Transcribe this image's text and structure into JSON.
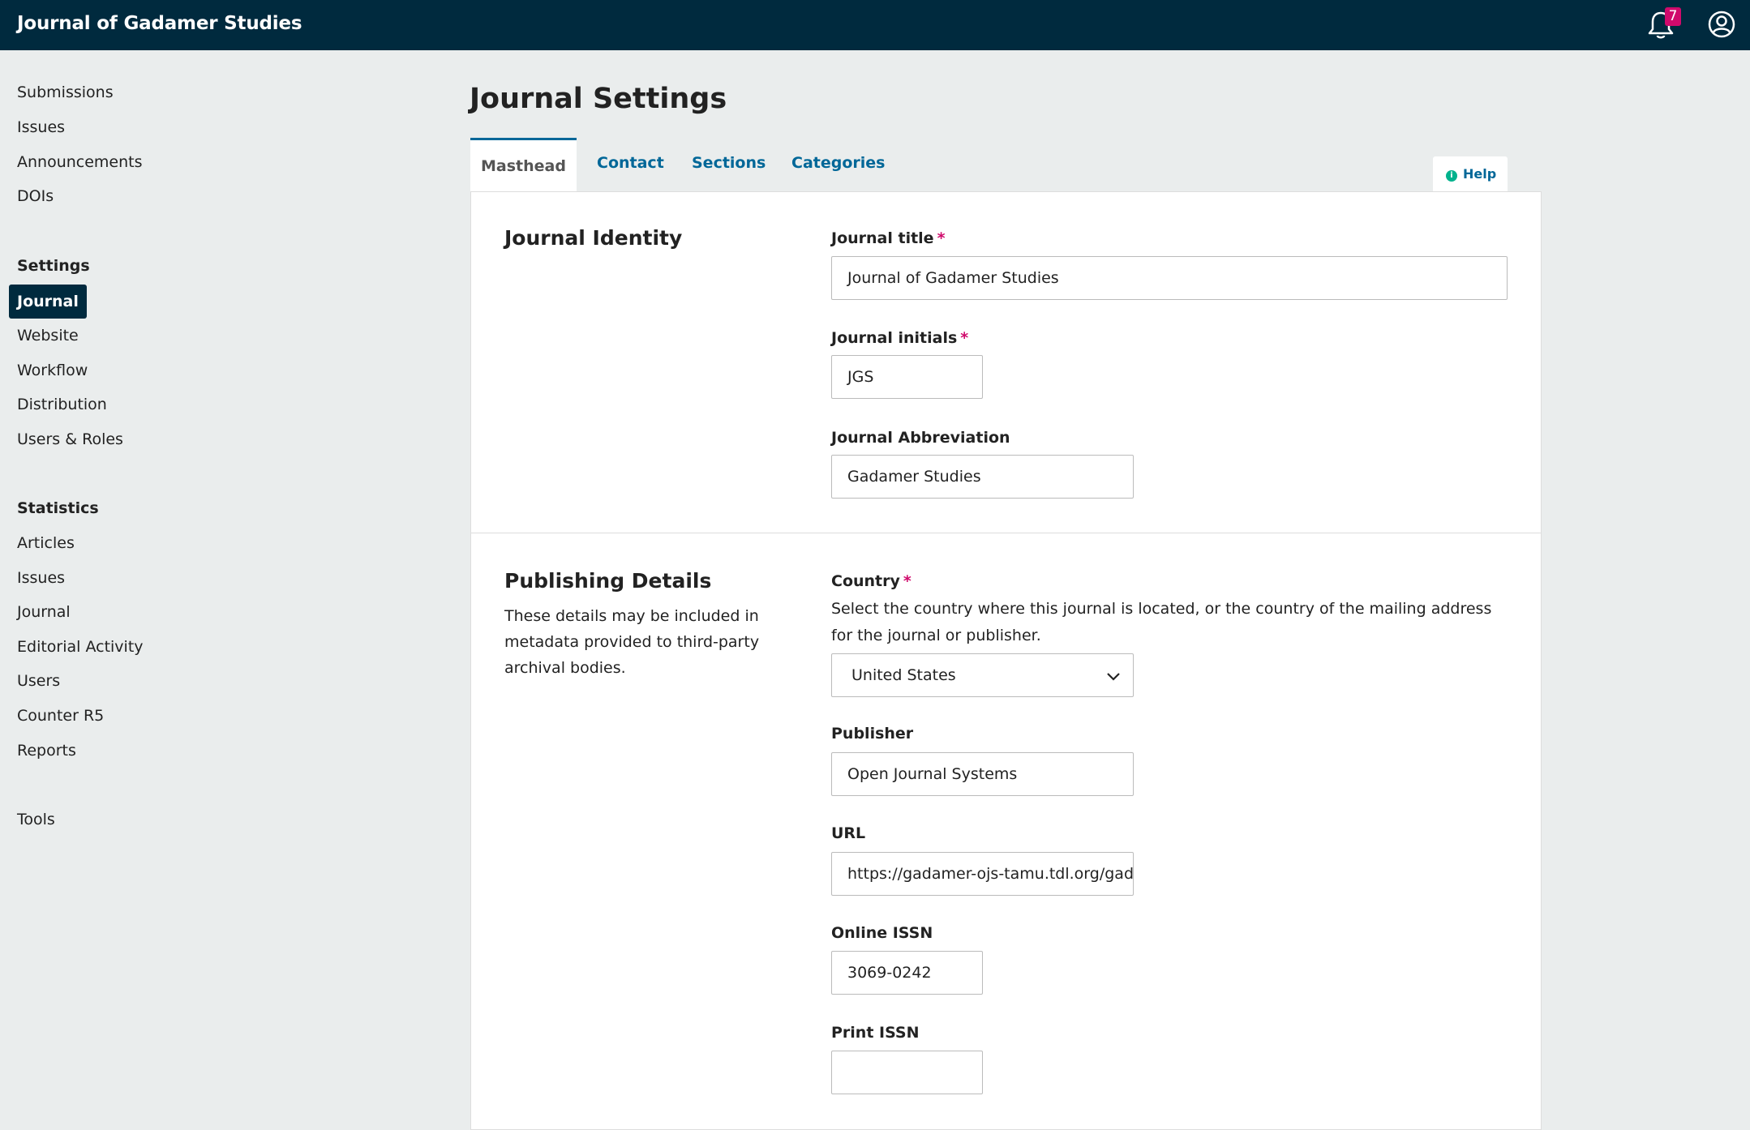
{
  "header": {
    "brand": "Journal of Gadamer Studies",
    "notification_count": "7"
  },
  "sidebar": {
    "top_items": [
      "Submissions",
      "Issues",
      "Announcements",
      "DOIs"
    ],
    "settings_heading": "Settings",
    "settings_items": [
      "Journal",
      "Website",
      "Workflow",
      "Distribution",
      "Users & Roles"
    ],
    "statistics_heading": "Statistics",
    "statistics_items": [
      "Articles",
      "Issues",
      "Journal",
      "Editorial Activity",
      "Users",
      "Counter R5",
      "Reports"
    ],
    "tools": "Tools"
  },
  "page": {
    "title": "Journal Settings",
    "tabs": [
      "Masthead",
      "Contact",
      "Sections",
      "Categories"
    ],
    "help": "Help"
  },
  "identity": {
    "title": "Journal Identity",
    "journal_title_label": "Journal title",
    "journal_title_value": "Journal of Gadamer Studies",
    "initials_label": "Journal initials",
    "initials_value": "JGS",
    "abbreviation_label": "Journal Abbreviation",
    "abbreviation_value": "Gadamer Studies"
  },
  "publishing": {
    "title": "Publishing Details",
    "description": "These details may be included in metadata provided to third-party archival bodies.",
    "country_label": "Country",
    "country_help": "Select the country where this journal is located, or the country of the mailing address for the journal or publisher.",
    "country_value": "United States",
    "publisher_label": "Publisher",
    "publisher_value": "Open Journal Systems",
    "url_label": "URL",
    "url_value": "https://gadamer-ojs-tamu.tdl.org/gad",
    "online_issn_label": "Online ISSN",
    "online_issn_value": "3069-0242",
    "print_issn_label": "Print ISSN",
    "print_issn_value": ""
  },
  "required_marker": "*",
  "colors": {
    "header_bg": "#002a3e",
    "link": "#006798",
    "required": "#d00a6c",
    "help_icon": "#00b28d"
  }
}
